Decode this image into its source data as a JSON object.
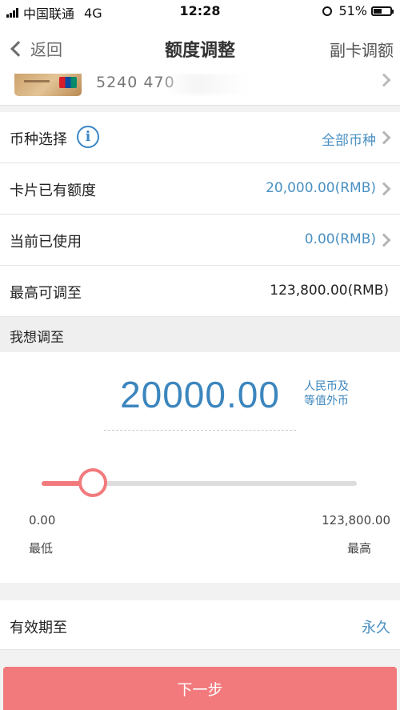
{
  "status_bar": {
    "carrier": "中国联通",
    "network": "4G",
    "time": "12:28",
    "battery_percent": "51%",
    "battery_level": 0.51
  },
  "nav": {
    "back_label": "返回",
    "title": "额度调整",
    "right_label": "副卡调额"
  },
  "card": {
    "number_partial": "5240 470"
  },
  "rows": {
    "currency": {
      "label": "币种选择",
      "value": "全部币种"
    },
    "existing_limit": {
      "label": "卡片已有额度",
      "value": "20,000.00(RMB)"
    },
    "used": {
      "label": "当前已使用",
      "value": "0.00(RMB)"
    },
    "max_adjust": {
      "label": "最高可调至",
      "value": "123,800.00(RMB)"
    }
  },
  "section_header": "我想调至",
  "adjust": {
    "amount": "20000.00",
    "currency_note_line1": "人民币及",
    "currency_note_line2": "等值外币",
    "slider": {
      "min": 0,
      "max": 123800,
      "value": 20000
    },
    "min_value": "0.00",
    "max_value": "123,800.00",
    "min_label": "最低",
    "max_label": "最高"
  },
  "expiry": {
    "label": "有效期至",
    "value": "永久"
  },
  "next_button": "下一步",
  "colors": {
    "accent_blue": "#4a90c2",
    "amount_blue": "#3c86be",
    "slider_red": "#f27a7d",
    "button_red": "#f27a7d"
  }
}
